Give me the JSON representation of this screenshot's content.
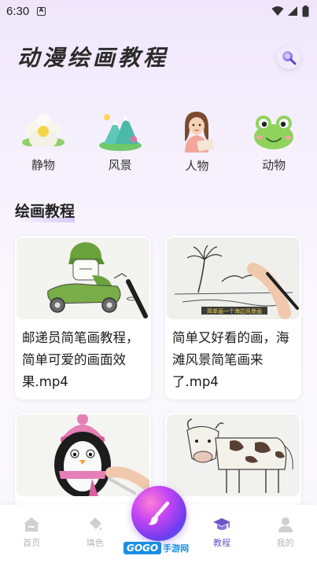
{
  "status_bar": {
    "time": "6:30"
  },
  "header": {
    "title": "动漫绘画教程"
  },
  "categories": [
    {
      "label": "静物",
      "icon": "flower-icon"
    },
    {
      "label": "风景",
      "icon": "mountain-icon"
    },
    {
      "label": "人物",
      "icon": "person-icon"
    },
    {
      "label": "动物",
      "icon": "frog-icon"
    }
  ],
  "section": {
    "title": "绘画教程"
  },
  "tutorials": [
    {
      "title": "邮递员简笔画教程，简单可爱的画面效果.mp4"
    },
    {
      "title": "简单又好看的画，海滩风景简笔画来了.mp4",
      "thumb_caption": "简单画一个海边风景画"
    },
    {
      "title": ""
    },
    {
      "title": ""
    }
  ],
  "bottom_nav": {
    "items": [
      {
        "label": "首页"
      },
      {
        "label": "填色"
      },
      {
        "label": "教程"
      },
      {
        "label": "我的"
      }
    ],
    "active": "教程"
  },
  "watermark": {
    "gogo": "GOGO",
    "brand": "手游网"
  },
  "colors": {
    "accent": "#6b55c9",
    "inactive": "#b6b6b6"
  }
}
